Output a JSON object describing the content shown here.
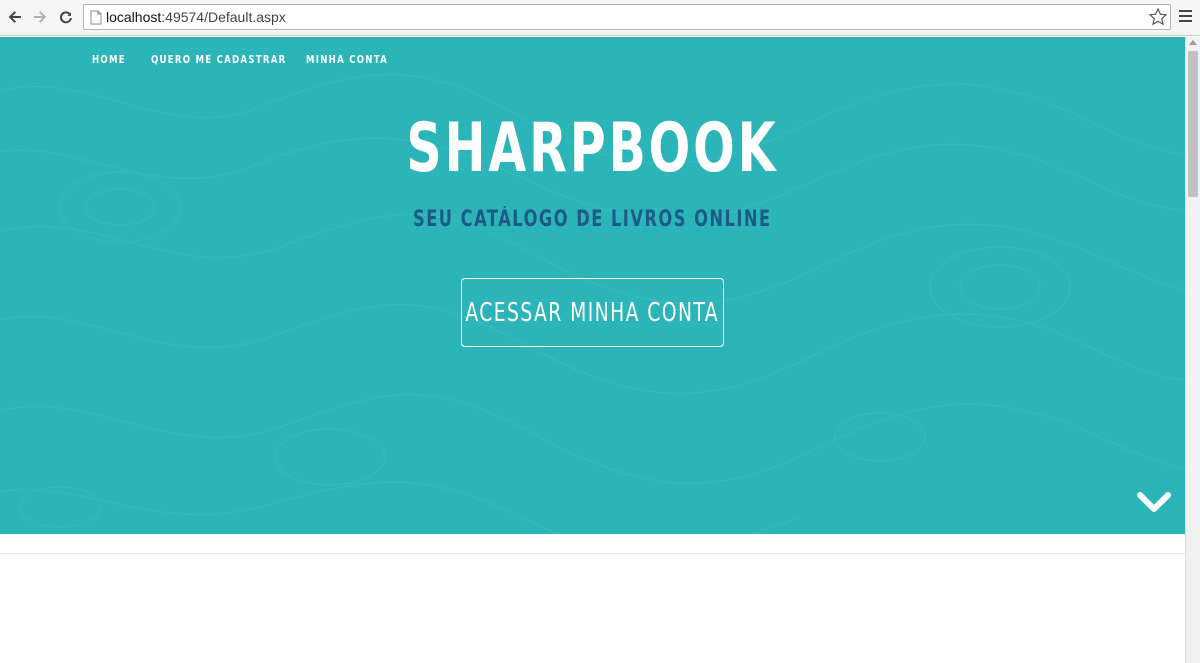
{
  "browser": {
    "url_host": "localhost",
    "url_rest": ":49574/Default.aspx"
  },
  "nav": {
    "items": [
      "HOME",
      "QUERO ME CADASTRAR",
      "MINHA CONTA"
    ]
  },
  "hero": {
    "title": "SHARPBOOK",
    "subtitle": "SEU CATÁLOGO DE LIVROS ONLINE",
    "cta_label": "ACESSAR MINHA CONTA",
    "background_color": "#2cb5b8",
    "subtitle_color": "#1d5a87"
  },
  "icons": {
    "back": "back-arrow-icon",
    "forward": "forward-arrow-icon",
    "reload": "reload-icon",
    "page": "page-icon",
    "star": "star-icon",
    "menu": "hamburger-menu-icon",
    "scroll_down": "chevron-down-icon"
  }
}
